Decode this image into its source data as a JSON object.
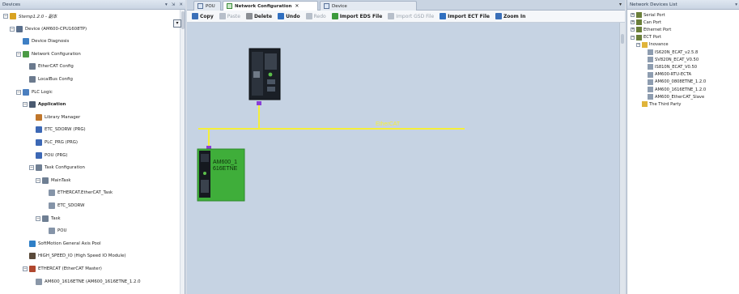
{
  "devices_panel": {
    "title": "Devices",
    "controls": [
      "▾",
      "⇲",
      "✕"
    ],
    "tree": [
      {
        "label": "Stemp1.2.0 - 副本",
        "expander": "−",
        "icon": "project-icon",
        "italic": true
      },
      {
        "label": "Device (AM600-CPU1608TP)",
        "expander": "−",
        "icon": "device-icon"
      },
      {
        "label": "Device Diagnosis",
        "icon": "diagnosis-icon"
      },
      {
        "label": "Network Configuration",
        "expander": "−",
        "icon": "network-config-icon"
      },
      {
        "label": "EtherCAT Config",
        "icon": "ethercat-config-icon"
      },
      {
        "label": "LocalBus Config",
        "icon": "localbus-config-icon"
      },
      {
        "label": "PLC Logic",
        "expander": "−",
        "icon": "plc-logic-icon"
      },
      {
        "label": "Application",
        "expander": "−",
        "icon": "application-icon",
        "bold": true
      },
      {
        "label": "Library Manager",
        "icon": "library-manager-icon"
      },
      {
        "label": "ETC_SDORW (PRG)",
        "icon": "pou-icon"
      },
      {
        "label": "PLC_PRG (PRG)",
        "icon": "pou-icon"
      },
      {
        "label": "POU (PRG)",
        "icon": "pou-icon"
      },
      {
        "label": "Task Configuration",
        "expander": "−",
        "icon": "task-config-icon"
      },
      {
        "label": "MainTask",
        "expander": "−",
        "icon": "task-icon"
      },
      {
        "label": "ETHERCAT.EtherCAT_Task",
        "icon": "task-call-icon"
      },
      {
        "label": "ETC_SDORW",
        "icon": "task-call-icon"
      },
      {
        "label": "Task",
        "expander": "−",
        "icon": "task-icon"
      },
      {
        "label": "POU",
        "icon": "task-call-icon"
      },
      {
        "label": "SoftMotion General Axis Pool",
        "icon": "axis-pool-icon"
      },
      {
        "label": "HIGH_SPEED_IO (High Speed IO Module)",
        "icon": "io-module-icon"
      },
      {
        "label": "ETHERCAT (EtherCAT Master)",
        "expander": "−",
        "icon": "ethercat-master-icon"
      },
      {
        "label": "AM600_1616ETNE (AM600_1616ETNE_1.2.0",
        "icon": "slave-device-icon"
      }
    ]
  },
  "editor": {
    "tabs": [
      {
        "label": "POU",
        "active": false,
        "closable": false
      },
      {
        "label": "Network Configuration",
        "active": true,
        "closable": true
      },
      {
        "label": "Device",
        "active": false,
        "closable": false
      }
    ],
    "tabs_dropdown": "▾",
    "close_glyph": "✕",
    "toolbar": [
      {
        "label": "Copy",
        "enabled": true,
        "icon": "copy-icon"
      },
      {
        "label": "Paste",
        "enabled": false,
        "icon": "paste-icon"
      },
      {
        "label": "Delete",
        "enabled": true,
        "icon": "delete-icon"
      },
      {
        "label": "Undo",
        "enabled": true,
        "icon": "undo-icon"
      },
      {
        "label": "Redo",
        "enabled": false,
        "icon": "redo-icon"
      },
      {
        "label": "Import EDS File",
        "enabled": true,
        "icon": "import-eds-icon"
      },
      {
        "label": "Import GSD File",
        "enabled": false,
        "icon": "import-gsd-icon"
      },
      {
        "label": "Import ECT File",
        "enabled": true,
        "icon": "import-ect-icon"
      },
      {
        "label": "Zoom In",
        "enabled": true,
        "icon": "zoom-in-icon"
      }
    ],
    "canvas": {
      "bus_label": "EtherCAT",
      "slave_label_line1": "AM600_1",
      "slave_label_line2": "616ETNE",
      "colors": {
        "bus": "#f5ef3a",
        "background": "#c6d3e3",
        "slave_highlight": "#3fae3a",
        "port": "#8a3fd6"
      }
    }
  },
  "network_devices": {
    "title": "Network Devices List",
    "controls": [
      "▾"
    ],
    "tree": [
      {
        "label": "Serial Port",
        "expander": "+",
        "icon": "port-icon"
      },
      {
        "label": "Can Port",
        "expander": "+",
        "icon": "port-icon"
      },
      {
        "label": "Ethernet Port",
        "expander": "+",
        "icon": "port-icon"
      },
      {
        "label": "ECT Port",
        "expander": "−",
        "icon": "port-icon"
      },
      {
        "label": "Inovance",
        "expander": "−",
        "icon": "folder-icon"
      },
      {
        "label": "IS620N_ECAT_v2.5.8",
        "icon": "device-entry-icon"
      },
      {
        "label": "SV820N_ECAT_V0.50",
        "icon": "device-entry-icon"
      },
      {
        "label": "IS810N_ECAT_V0.50",
        "icon": "device-entry-icon"
      },
      {
        "label": "AM600-RTU-ECTA",
        "icon": "device-entry-icon"
      },
      {
        "label": "AM600_0808ETNE_1.2.0",
        "icon": "device-entry-icon"
      },
      {
        "label": "AM600_1616ETNE_1.2.0",
        "icon": "device-entry-icon"
      },
      {
        "label": "AM600_EtherCAT_Slave",
        "icon": "device-entry-icon"
      },
      {
        "label": "The Third Party",
        "icon": "folder-icon"
      }
    ]
  }
}
